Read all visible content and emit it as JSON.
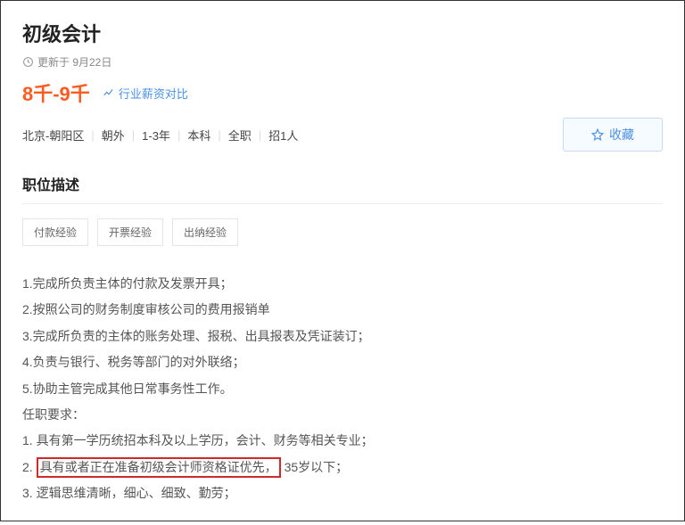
{
  "job": {
    "title": "初级会计",
    "updated": "更新于 9月22日",
    "salary": "8千-9千",
    "salary_compare": "行业薪资对比"
  },
  "meta": {
    "location": "北京-朝阳区",
    "area": "朝外",
    "experience": "1-3年",
    "education": "本科",
    "type": "全职",
    "headcount": "招1人"
  },
  "favorite_label": "收藏",
  "section_title": "职位描述",
  "skills": [
    "付款经验",
    "开票经验",
    "出纳经验"
  ],
  "desc": {
    "d1": "1.完成所负责主体的付款及发票开具；",
    "d2": "2.按照公司的财务制度审核公司的费用报销单",
    "d3": "3.完成所负责的主体的账务处理、报税、出具报表及凭证装订；",
    "d4": "4.负责与银行、税务等部门的对外联络；",
    "d5": "5.协助主管完成其他日常事务性工作。",
    "req_title": "任职要求：",
    "r1": "1. 具有第一学历统招本科及以上学历，会计、财务等相关专业；",
    "r2_prefix": "2. ",
    "r2_hl": "具有或者正在准备初级会计师资格证优先，",
    "r2_suffix": "35岁以下；",
    "r3": "3. 逻辑思维清晰，细心、细致、勤劳；"
  }
}
